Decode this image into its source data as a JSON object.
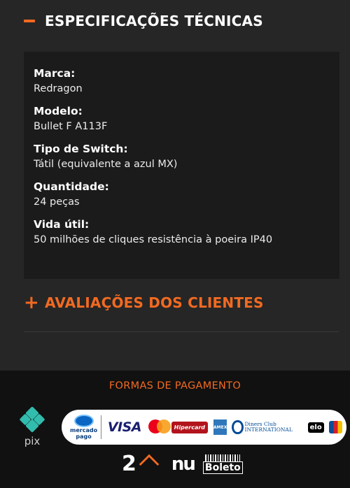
{
  "spec_section": {
    "title": "ESPECIFICAÇÕES TÉCNICAS",
    "items": [
      {
        "label": "Marca:",
        "value": "Redragon"
      },
      {
        "label": "Modelo:",
        "value": "Bullet F A113F"
      },
      {
        "label": "Tipo de Switch:",
        "value": "Tátil (equivalente a azul MX)"
      },
      {
        "label": "Quantidade:",
        "value": "24 peças"
      },
      {
        "label": "Vida útil:",
        "value": "50 milhões de cliques resistência à poeira IP40"
      }
    ]
  },
  "reviews_section": {
    "title": "AVALIAÇÕES DOS CLIENTES"
  },
  "footer": {
    "payment_title": "FORMAS DE PAGAMENTO",
    "pix_label": "pix",
    "mercado_pago": "mercado pago",
    "visa": "VISA",
    "hipercard": "Hipercard",
    "amex": "AMEX",
    "diners": "Diners Club INTERNATIONAL",
    "elo": "elo",
    "two_label": "2",
    "nu_label": "nu",
    "boleto_label": "Boleto"
  },
  "colors": {
    "accent": "#f26a21",
    "background": "#262626",
    "panel": "#1b1b1b",
    "footer": "#111111"
  }
}
